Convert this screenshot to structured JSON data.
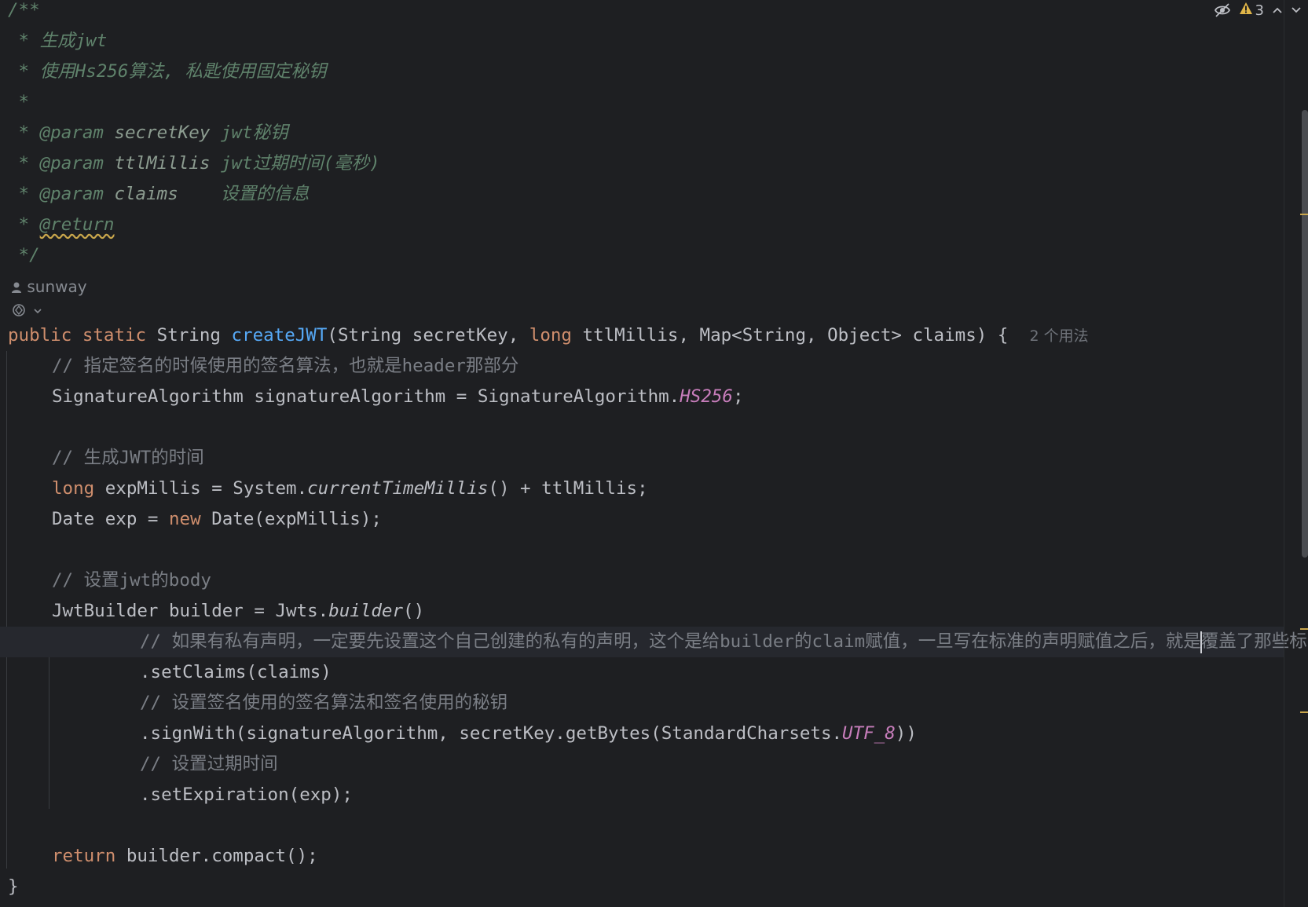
{
  "toolbar": {
    "warning_count": "3",
    "icons": [
      "eye-off-icon",
      "warning-icon",
      "chevron-up-icon",
      "chevron-down-icon"
    ]
  },
  "doc": {
    "open": "/**",
    "l1": " * 生成jwt",
    "l2": " * 使用Hs256算法, 私匙使用固定秘钥",
    "l3": " *",
    "p1_tag": "@param",
    "p1_name": "secretKey",
    "p1_desc": "jwt秘钥",
    "p2_tag": "@param",
    "p2_name": "ttlMillis",
    "p2_desc": "jwt过期时间(毫秒)",
    "p3_tag": "@param",
    "p3_name": "claims",
    "p3_desc": "设置的信息",
    "ret_tag": "@return",
    "close": " */"
  },
  "author": "sunway",
  "sig": {
    "mod1": "public",
    "mod2": "static",
    "ret": "String",
    "name": "createJWT",
    "params_a": "(String secretKey, ",
    "kw_long": "long",
    "params_b": " ttlMillis, Map<String, Object> claims) {",
    "usages": "2 个用法"
  },
  "body": {
    "c1": "// 指定签名的时候使用的签名算法，也就是header那部分",
    "s1a": "SignatureAlgorithm signatureAlgorithm = SignatureAlgorithm.",
    "s1b": "HS256",
    "s1c": ";",
    "c2": "// 生成JWT的时间",
    "s2kw": "long",
    "s2a": " expMillis = System.",
    "s2b": "currentTimeMillis",
    "s2c": "() + ttlMillis;",
    "s3a": "Date exp = ",
    "s3kw": "new",
    "s3b": " Date(expMillis);",
    "c3": "// 设置jwt的body",
    "s4a": "JwtBuilder builder = Jwts.",
    "s4b": "builder",
    "s4c": "()",
    "c4a": "// 如果有私有声明，一定要先设置这个自己创建的私有的声明，这个是给builder的claim赋值，一旦写在标准的声明赋值之后，就是",
    "c4b": "覆盖了那些标准",
    "s5": ".setClaims(claims)",
    "c5": "// 设置签名使用的签名算法和签名使用的秘钥",
    "s6a": ".signWith(signatureAlgorithm, secretKey.getBytes(StandardCharsets.",
    "s6b": "UTF_8",
    "s6c": "))",
    "c6": "// 设置过期时间",
    "s7": ".setExpiration(exp);",
    "rkw": "return",
    "r": " builder.compact();",
    "close": "}"
  }
}
